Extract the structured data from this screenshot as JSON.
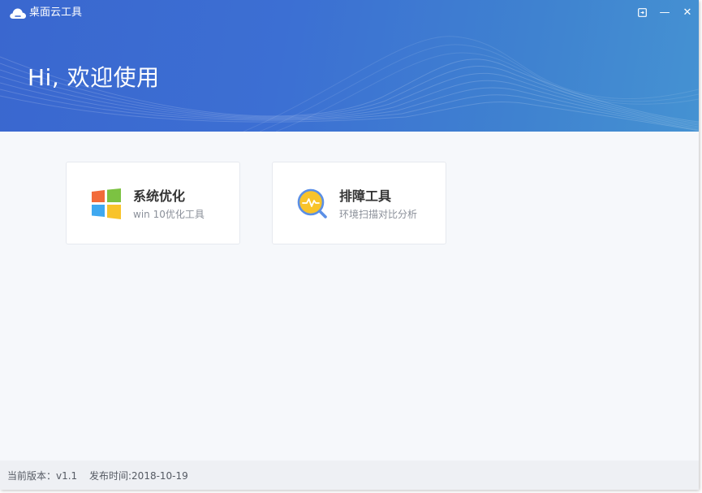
{
  "window": {
    "title": "桌面云工具",
    "controls": {
      "restore_icon": "restore-icon",
      "minimize": "—",
      "close": "✕"
    }
  },
  "banner": {
    "greeting": "Hi, 欢迎使用"
  },
  "cards": [
    {
      "title": "系统优化",
      "subtitle": "win 10优化工具",
      "icon": "windows-logo-icon"
    },
    {
      "title": "排障工具",
      "subtitle": "环境扫描对比分析",
      "icon": "diagnostic-magnifier-icon"
    }
  ],
  "status": {
    "version": "当前版本：v1.1",
    "release": "发布时间:2018-10-19"
  },
  "colors": {
    "banner": "#3c6fd3",
    "accent_orange": "#f26b3a",
    "accent_green": "#7cc242",
    "accent_blue": "#3fa8f0",
    "accent_yellow": "#f8c32a"
  }
}
